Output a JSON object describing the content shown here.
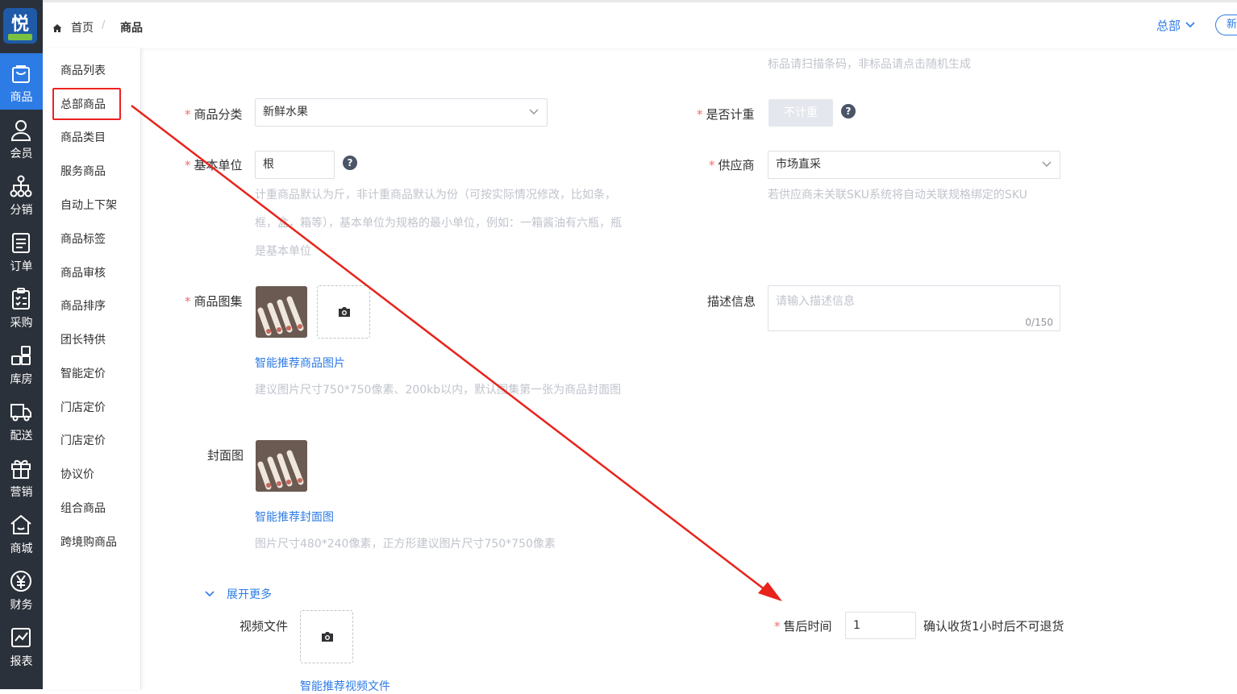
{
  "logo": {
    "text": "悦"
  },
  "rail": [
    {
      "label": "商品",
      "icon": "shopping-bag-icon",
      "active": true
    },
    {
      "label": "会员",
      "icon": "user-icon"
    },
    {
      "label": "分销",
      "icon": "network-icon"
    },
    {
      "label": "订单",
      "icon": "order-icon"
    },
    {
      "label": "采购",
      "icon": "clipboard-icon"
    },
    {
      "label": "库房",
      "icon": "warehouse-icon"
    },
    {
      "label": "配送",
      "icon": "truck-icon"
    },
    {
      "label": "营销",
      "icon": "gift-icon"
    },
    {
      "label": "商城",
      "icon": "store-icon"
    },
    {
      "label": "财务",
      "icon": "yen-icon"
    },
    {
      "label": "报表",
      "icon": "chart-icon"
    }
  ],
  "submenu": [
    "商品列表",
    "总部商品",
    "商品类目",
    "服务商品",
    "自动上下架",
    "商品标签",
    "商品审核",
    "商品排序",
    "团长特供",
    "智能定价",
    "门店定价",
    "门店定价",
    "协议价",
    "组合商品",
    "跨境购商品"
  ],
  "breadcrumb": {
    "home": "首页",
    "sep": "/",
    "current": "商品"
  },
  "header": {
    "org": "总部",
    "new_btn": "新"
  },
  "form": {
    "top_hint": "标品请扫描条码，非标品请点击随机生成",
    "category": {
      "label": "商品分类",
      "value": "新鲜水果"
    },
    "weighing": {
      "label": "是否计重",
      "button": "不计重"
    },
    "unit": {
      "label": "基本单位",
      "value": "根",
      "hint1": "计重商品默认为斤，非计重商品默认为份（可按实际情况修改，比如条，",
      "hint2": "框，盒，箱等），基本单位为规格的最小单位，例如：一箱酱油有六瓶，瓶",
      "hint3": "是基本单位"
    },
    "supplier": {
      "label": "供应商",
      "value": "市场直采",
      "hint": "若供应商未关联SKU系统将自动关联规格绑定的SKU"
    },
    "gallery": {
      "label": "商品图集",
      "link": "智能推荐商品图片",
      "hint": "建议图片尺寸750*750像素、200kb以内，默认图集第一张为商品封面图"
    },
    "description": {
      "label": "描述信息",
      "placeholder": "请输入描述信息",
      "counter": "0/150"
    },
    "cover": {
      "label": "封面图",
      "link": "智能推荐封面图",
      "hint": "图片尺寸480*240像素，正方形建议图片尺寸750*750像素"
    },
    "expand": {
      "label": "展开更多"
    },
    "video": {
      "label": "视频文件",
      "link": "智能推荐视频文件"
    },
    "aftersale": {
      "label": "售后时间",
      "value": "1",
      "suffix": "确认收货1小时后不可退货"
    }
  },
  "annotation": {
    "color": "#e8231b"
  }
}
